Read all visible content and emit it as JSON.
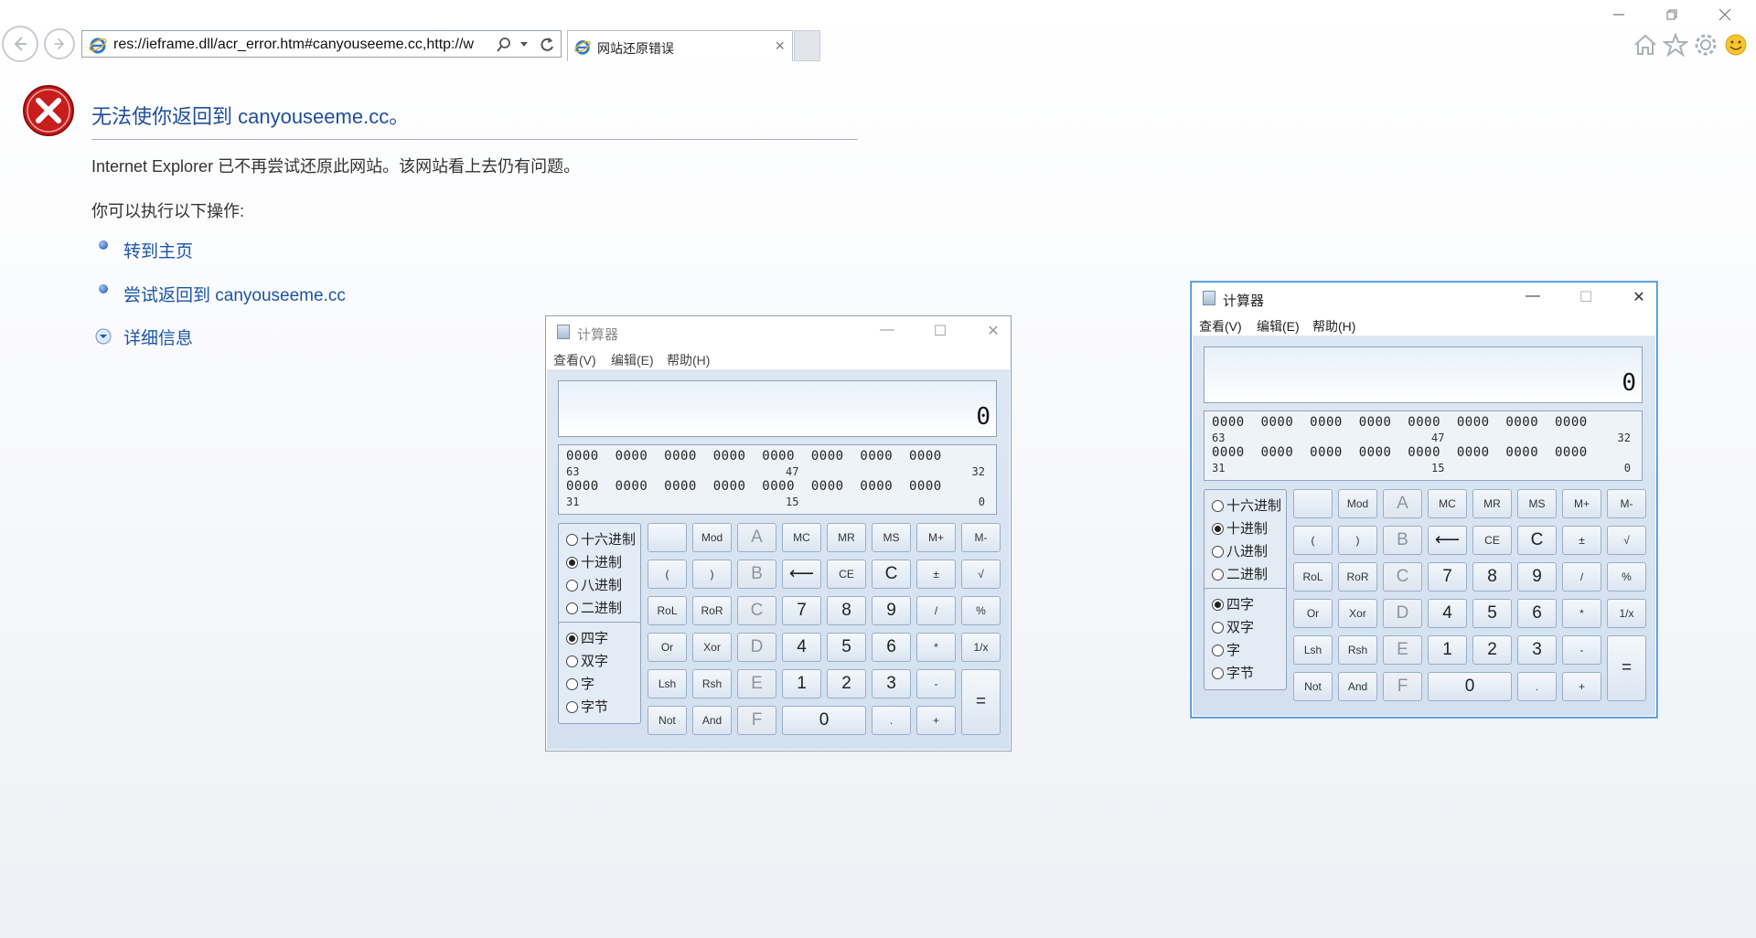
{
  "browser": {
    "address": "res://ieframe.dll/acr_error.htm#canyouseeme.cc,http://w",
    "tab_title": "网站还原错误",
    "tab_close": "×"
  },
  "error_page": {
    "title": "无法使你返回到 canyouseeme.cc。",
    "message": "Internet Explorer 已不再尝试还原此网站。该网站看上去仍有问题。",
    "subheading": "你可以执行以下操作:",
    "links": [
      "转到主页",
      "尝试返回到 canyouseeme.cc"
    ],
    "details": "详细信息"
  },
  "calc_inactive": {
    "title": "计算器",
    "menus": [
      "查看(V)",
      "编辑(E)",
      "帮助(H)"
    ],
    "display": "0",
    "bits_row1": "0000  0000  0000  0000  0000  0000  0000  0000",
    "bits_idx1": [
      "63",
      "47",
      "32"
    ],
    "bits_row2": "0000  0000  0000  0000  0000  0000  0000  0000",
    "bits_idx2": [
      "31",
      "15",
      "0"
    ],
    "radix": [
      "十六进制",
      "十进制",
      "八进制",
      "二进制"
    ],
    "word": [
      "四字",
      "双字",
      "字",
      "字节"
    ]
  },
  "calc_active": {
    "title": "计算器",
    "menus": [
      "查看(V)",
      "编辑(E)",
      "帮助(H)"
    ],
    "display": "0",
    "bits_row1": "0000  0000  0000  0000  0000  0000  0000  0000",
    "bits_idx1": [
      "63",
      "47",
      "32"
    ],
    "bits_row2": "0000  0000  0000  0000  0000  0000  0000  0000",
    "bits_idx2": [
      "31",
      "15",
      "0"
    ],
    "radix": [
      "十六进制",
      "十进制",
      "八进制",
      "二进制"
    ],
    "word": [
      "四字",
      "双字",
      "字",
      "字节"
    ]
  },
  "keys": {
    "row1": [
      "",
      "Mod",
      "A",
      "MC",
      "MR",
      "MS",
      "M+",
      "M-"
    ],
    "row2": [
      "(",
      ")",
      "B",
      "⟵",
      "CE",
      "C",
      "±",
      "√"
    ],
    "row3": [
      "RoL",
      "RoR",
      "C",
      "7",
      "8",
      "9",
      "/",
      "%"
    ],
    "row4": [
      "Or",
      "Xor",
      "D",
      "4",
      "5",
      "6",
      "*",
      "1/x"
    ],
    "row5": [
      "Lsh",
      "Rsh",
      "E",
      "1",
      "2",
      "3",
      "-"
    ],
    "row6": [
      "Not",
      "And",
      "F",
      "0",
      ".",
      "+"
    ],
    "equals": "="
  }
}
